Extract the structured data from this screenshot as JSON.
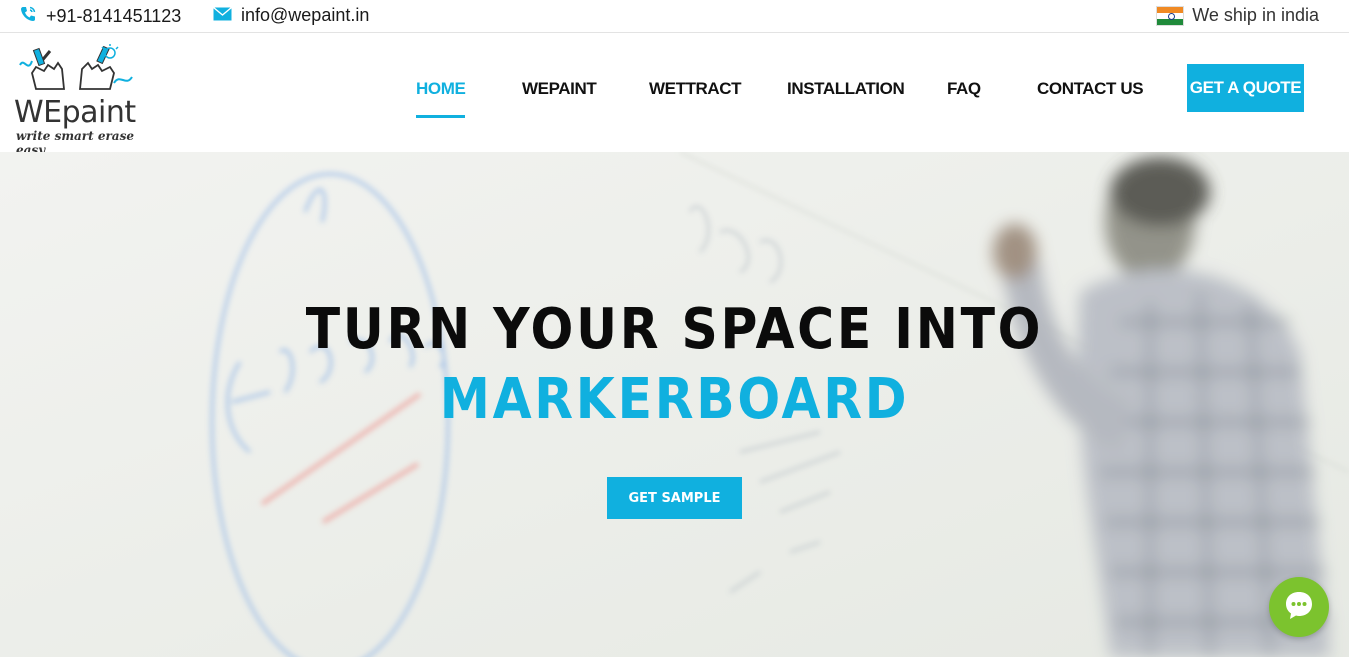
{
  "topbar": {
    "phone": "+91-8141451123",
    "email": "info@wepaint.in",
    "ship_text": "We ship in india",
    "icons": {
      "phone": "phone-icon",
      "email": "mail-icon",
      "flag": "india-flag-icon"
    }
  },
  "logo": {
    "brand": "WEpaint",
    "tagline": "write smart erase easy"
  },
  "nav": {
    "items": [
      {
        "label": "HOME",
        "active": true
      },
      {
        "label": "WEPAINT",
        "active": false
      },
      {
        "label": "WETTRACT",
        "active": false
      },
      {
        "label": "INSTALLATION",
        "active": false
      },
      {
        "label": "FAQ",
        "active": false
      },
      {
        "label": "CONTACT US",
        "active": false
      }
    ],
    "cta": "GET A QUOTE"
  },
  "hero": {
    "title": "TURN YOUR SPACE INTO",
    "subtitle": "MARKERBOARD",
    "button": "GET SAMPLE"
  },
  "colors": {
    "accent": "#10b0df",
    "chat": "#7cc32e",
    "text": "#111111"
  }
}
